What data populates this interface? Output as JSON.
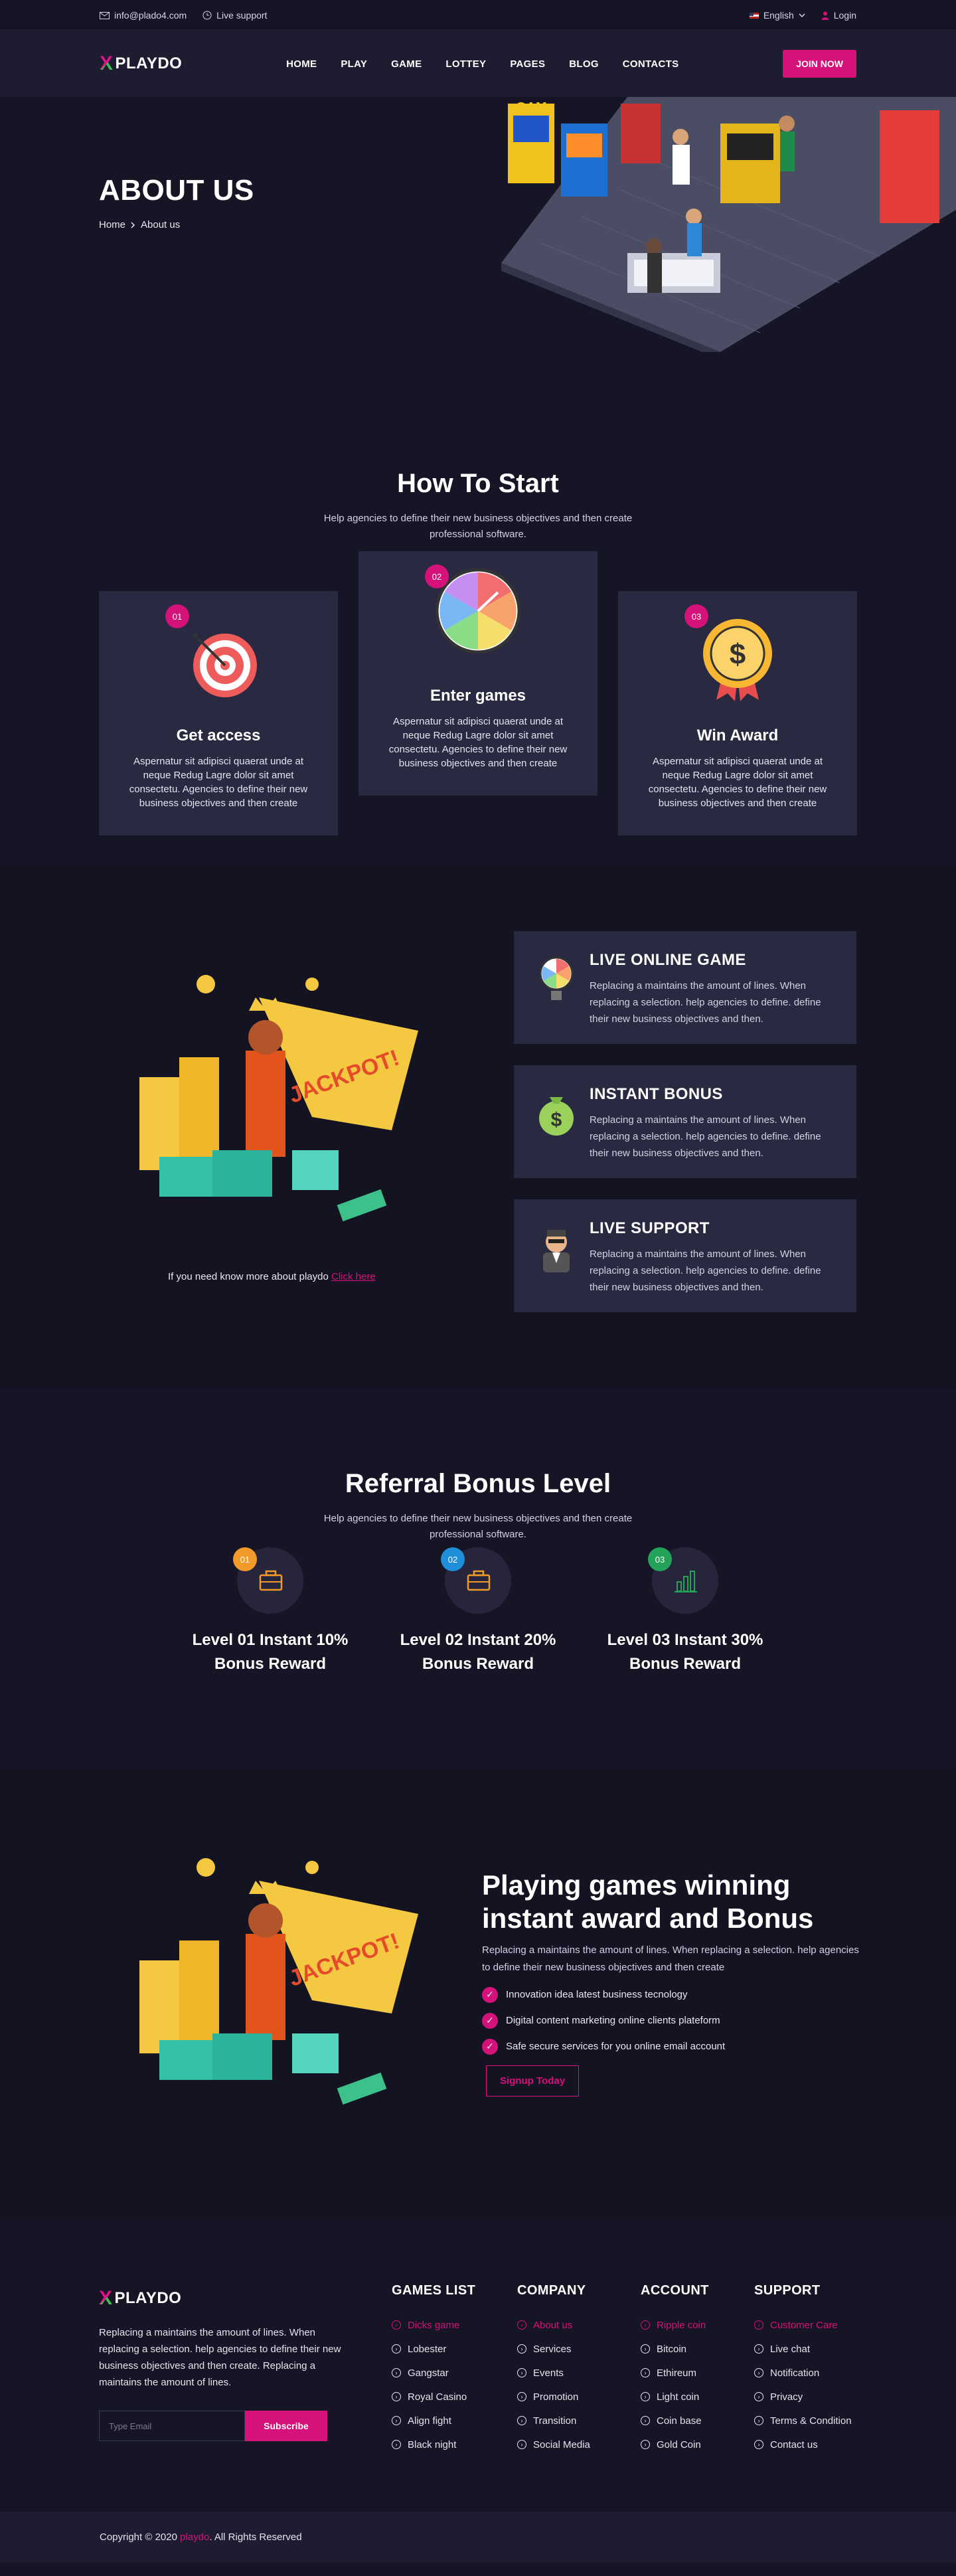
{
  "topbar": {
    "email": "info@plado4.com",
    "support": "Live support",
    "language": "English",
    "login": "Login"
  },
  "header": {
    "logo_text": "PLAYDO",
    "nav": [
      "HOME",
      "PLAY",
      "GAME",
      "LOTTEY",
      "PAGES",
      "BLOG",
      "CONTACTS"
    ],
    "cta": "JOIN NOW"
  },
  "hero": {
    "title": "ABOUT US",
    "breadcrumb_home": "Home",
    "breadcrumb_current": "About us"
  },
  "how": {
    "title": "How To Start",
    "subtitle": "Help agencies to define their new business objectives and then create professional software.",
    "steps": [
      {
        "num": "01",
        "title": "Get access",
        "text": "Aspernatur sit adipisci quaerat unde at neque Redug Lagre dolor sit amet consectetu. Agencies to define their new business objectives and then create",
        "icon": "target-icon"
      },
      {
        "num": "02",
        "title": "Enter games",
        "text": "Aspernatur sit adipisci quaerat unde at neque Redug Lagre dolor sit amet consectetu. Agencies to define their new business objectives and then create",
        "icon": "wheel-icon"
      },
      {
        "num": "03",
        "title": "Win Award",
        "text": "Aspernatur sit adipisci quaerat unde at neque Redug Lagre dolor sit amet consectetu. Agencies to define their new business objectives and then create",
        "icon": "award-icon"
      }
    ]
  },
  "features": {
    "items": [
      {
        "title": "LIVE ONLINE GAME",
        "text": "Replacing a maintains the amount of lines. When replacing a selection. help agencies to define. define their new business objectives and then.",
        "icon": "wheel-icon"
      },
      {
        "title": "INSTANT BONUS",
        "text": "Replacing a maintains the amount of lines. When replacing a selection. help agencies to define. define their new business objectives and then.",
        "icon": "money-bag-icon"
      },
      {
        "title": "LIVE SUPPORT",
        "text": "Replacing a maintains the amount of lines. When replacing a selection. help agencies to define. define their new business objectives and then.",
        "icon": "agent-icon"
      }
    ],
    "more_text": "If you need know more about playdo",
    "more_link": "Click here"
  },
  "referral": {
    "title": "Referral Bonus Level",
    "subtitle": "Help agencies to define their new business objectives and then create professional software.",
    "levels": [
      {
        "num": "01",
        "line1": "Level 01 Instant 10%",
        "line2": "Bonus Reward",
        "color": "#f19a2a",
        "icon": "briefcase-icon"
      },
      {
        "num": "02",
        "line1": "Level 02 Instant 20%",
        "line2": "Bonus Reward",
        "color": "#1e8fd8",
        "icon": "briefcase-icon"
      },
      {
        "num": "03",
        "line1": "Level 03 Instant 30%",
        "line2": "Bonus Reward",
        "color": "#23a35a",
        "icon": "bar-chart-icon"
      }
    ]
  },
  "winning": {
    "title": "Playing games winning instant award and Bonus",
    "desc": "Replacing a maintains the amount of lines. When replacing a selection. help agencies to define their new business objectives and then create",
    "checks": [
      "Innovation idea latest business tecnology",
      "Digital content marketing online clients plateform",
      "Safe secure services for you online email account"
    ],
    "cta": "Signup Today"
  },
  "footer": {
    "logo_text": "PLAYDO",
    "desc": "Replacing a maintains the amount of lines. When replacing a selection. help agencies to define their new business objectives and then create. Replacing a maintains the amount of lines.",
    "email_placeholder": "Type Email",
    "subscribe": "Subscribe",
    "columns": [
      {
        "title": "GAMES LIST",
        "items": [
          "Dicks game",
          "Lobester",
          "Gangstar",
          "Royal Casino",
          "Align fight",
          "Black night"
        ]
      },
      {
        "title": "COMPANY",
        "items": [
          "About us",
          "Services",
          "Events",
          "Promotion",
          "Transition",
          "Social Media"
        ]
      },
      {
        "title": "ACCOUNT",
        "items": [
          "Ripple coin",
          "Bitcoin",
          "Ethireum",
          "Light coin",
          "Coin base",
          "Gold Coin"
        ]
      },
      {
        "title": "SUPPORT",
        "items": [
          "Customer Care",
          "Live chat",
          "Notification",
          "Privacy",
          "Terms & Condition",
          "Contact us"
        ]
      }
    ]
  },
  "copyright": {
    "prefix": "Copyright © 2020",
    "brand": "playdo",
    "suffix": ". All Rights Reserved"
  },
  "colors": {
    "accent": "#d5117a",
    "background": "#161526",
    "card": "#2a2942"
  }
}
